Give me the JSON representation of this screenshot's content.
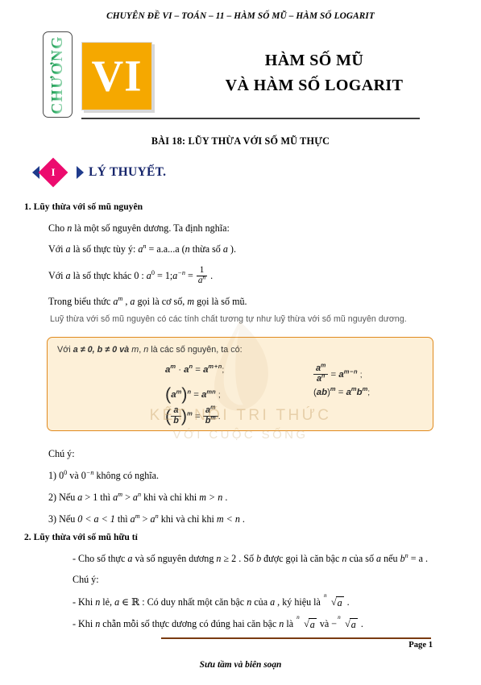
{
  "running_head": "CHUYÊN ĐỀ VI – TOÁN – 11  – HÀM SỐ MŨ – HÀM SỐ LOGARIT",
  "chapter": {
    "word": "CHƯƠNG",
    "numeral": "VI",
    "badge_color": "#f5a800",
    "word_color": "#2f9c58"
  },
  "title": {
    "line1": "HÀM SỐ MŨ",
    "line2": "VÀ HÀM SỐ LOGARIT"
  },
  "lesson_title": "BÀI 18: LŨY THỪA VỚI SỐ MŨ THỰC",
  "section_heading": {
    "marker": "I",
    "label": "LÝ THUYẾT.",
    "marker_color": "#ec0b6e",
    "chevron_color": "#1f3b8c",
    "text_color": "#16256b"
  },
  "part1": {
    "heading": "1. Lũy thừa với số mũ nguyên",
    "line_intro_a": "Cho ",
    "line_intro_var": "n",
    "line_intro_b": " là một số nguyên dương. Ta định nghĩa:",
    "def1_pre": "Với ",
    "def1_var": "a",
    "def1_mid": " là số thực tùy ý: ",
    "def1_base": "a",
    "def1_exp": "n",
    "def1_eq": " = a.a...a (",
    "def1_n": "n",
    "def1_tail": " thừa số ",
    "def1_a2": "a",
    "def1_close": " ).",
    "def2_pre": "Với ",
    "def2_var": "a",
    "def2_mid": " là số thực khác ",
    "def2_zero": "0",
    "def2_colon": " : ",
    "def2_a0": "a",
    "def2_a0exp": "0",
    "def2_eq1": " = 1;",
    "def2_a2": "a",
    "def2_a2exp": "−n",
    "def2_eq2": " = ",
    "frac_num": "1",
    "frac_den_base": "a",
    "frac_den_exp": "n",
    "def2_end": " .",
    "line_terms_a": "Trong biểu thức ",
    "line_terms_base": "a",
    "line_terms_exp": "m",
    "line_terms_b": " , ",
    "line_terms_var1": "a",
    "line_terms_c": "  gọi là cơ số, ",
    "line_terms_var2": "m",
    "line_terms_d": "  gọi là số mũ.",
    "grey_note": "Luỹ thừa với số mũ nguyên có các tính chất tương tự như luỹ thừa với số mũ nguyên dương."
  },
  "formula_box": {
    "bg_color": "#fdf0d8",
    "border_color": "#e08a1e",
    "head_pre": "Với ",
    "head_a": "a",
    "head_ne1": " ≠ 0, ",
    "head_b": "b",
    "head_ne2": " ≠ 0 và ",
    "head_m": "m",
    "head_comma": ", ",
    "head_n": "n",
    "head_tail": " là các số nguyên, ta có:",
    "f1": "aᵐ · aⁿ = aᵐ⁺ⁿ;",
    "f2": "(aᵐ)ⁿ = aᵐⁿ;",
    "f3": "(a/b)ᵐ = aᵐ/bᵐ.",
    "f4": "aᵐ/aⁿ = aᵐ⁻ⁿ;",
    "f5": "(ab)ᵐ = aᵐbᵐ;"
  },
  "notes": {
    "label": "Chú ý:",
    "n1_pre": "1) 0",
    "n1_exp": "0",
    "n1_mid": " và 0",
    "n1_exp2": "−n",
    "n1_tail": "  không có nghĩa.",
    "n2_pre": "2) Nếu ",
    "n2_a": "a",
    "n2_gt1": " > 1 thì ",
    "n2_am": "a",
    "n2_m": "m",
    "n2_gt": " > ",
    "n2_an": "a",
    "n2_n": "n",
    "n2_mid": "  khi và chỉ khi ",
    "n2_cond": "m > n",
    "n2_end": " .",
    "n3_pre": "3) Nếu ",
    "n3_range": "0 < a < 1",
    "n3_mid1": " thì ",
    "n3_am": "a",
    "n3_m": "m",
    "n3_gt": " > ",
    "n3_an": "a",
    "n3_n": "n",
    "n3_mid2": "  khi và chỉ khi ",
    "n3_cond": "m < n",
    "n3_end": " ."
  },
  "part2": {
    "heading": "2. Lũy thừa với số mũ hữu tỉ",
    "l1_pre": "- Cho số thực ",
    "l1_a": "a",
    "l1_mid1": "  và số nguyên dương ",
    "l1_n": "n",
    "l1_ge": " ≥ 2 . Số ",
    "l1_b": "b",
    "l1_mid2": "  được gọi là căn bậc ",
    "l1_n2": "n",
    "l1_mid3": "  của số ",
    "l1_a2": "a",
    "l1_mid4": "  nếu ",
    "l1_bn": "b",
    "l1_exp": "n",
    "l1_eq": " = a .",
    "note_label": "Chú ý:",
    "l2_pre": "- Khi ",
    "l2_n": "n",
    "l2_mid1": "  lẻ, ",
    "l2_a": "a",
    "l2_in": " ∈ ℝ",
    "l2_mid2": " : Có duy nhất một căn bậc ",
    "l2_n2": "n",
    "l2_mid3": "  của ",
    "l2_a2": "a",
    "l2_mid4": " , ký hiệu là ",
    "l2_rad_idx": "n",
    "l2_rad_body": "a",
    "l2_end": " .",
    "l3_pre": "- Khi ",
    "l3_n": "n",
    "l3_mid1": "  chẵn mỗi số thực dương có đúng hai căn bậc ",
    "l3_n2": "n",
    "l3_mid2": "  là ",
    "l3_rad1_idx": "n",
    "l3_rad1_body": "a",
    "l3_mid3": "  và ",
    "l3_minus": "−",
    "l3_rad2_idx": "n",
    "l3_rad2_body": "a",
    "l3_end": " ."
  },
  "watermark": {
    "line1": "KẾT NỐI TRI THỨC",
    "line2": "VỚI CUỘC SỐNG",
    "color": "#c9a46a"
  },
  "footer": {
    "page_label": "Page 1",
    "credit": "Sưu tầm và biên soạn",
    "rule_color": "#7a3b10"
  }
}
